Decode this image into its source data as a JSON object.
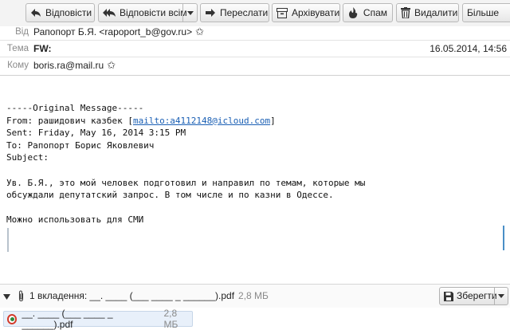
{
  "toolbar": {
    "reply": "Відповісти",
    "reply_all": "Відповісти всім",
    "forward": "Переслати",
    "archive": "Архівувати",
    "spam": "Спам",
    "delete": "Видалити",
    "more": "Більше"
  },
  "header": {
    "from_label": "Від",
    "from_value": "Рапопорт Б.Я. <rapoport_b@gov.ru>",
    "subject_label": "Тема",
    "subject_value": "FW:",
    "date": "16.05.2014, 14:56",
    "to_label": "Кому",
    "to_value": "boris.ra@mail.ru",
    "star_glyph": "✩"
  },
  "message": {
    "line_original": "-----Original Message-----",
    "from_prefix": "From: рашидович казбек [",
    "from_link": "mailto:a4112148@icloud.com",
    "from_suffix": "]",
    "sent": "Sent: Friday, May 16, 2014 3:15 PM",
    "to": "To: Рапопорт Борис Яковлевич",
    "subject": "Subject:",
    "para1_line1": "Ув. Б.Я., это мой человек подготовил и направил по темам, которые мы",
    "para1_line2": "обсуждали депутатский запрос. В том числе и по казни в Одессе.",
    "para2": "Можно использовать для СМИ"
  },
  "attachments": {
    "summary": "1 вкладення: __. ____ (___ ____ _ ______).pdf",
    "summary_size": "2,8 МБ",
    "save_label": "Зберегти",
    "items": [
      {
        "name": "__. ____ (___ ____ _ ______).pdf",
        "size": "2,8 МБ"
      }
    ]
  },
  "colors": {
    "link": "#1a5fb4",
    "toolbar_bg": "#f3f3f3",
    "attachment_highlight": "#e8f0fa"
  }
}
